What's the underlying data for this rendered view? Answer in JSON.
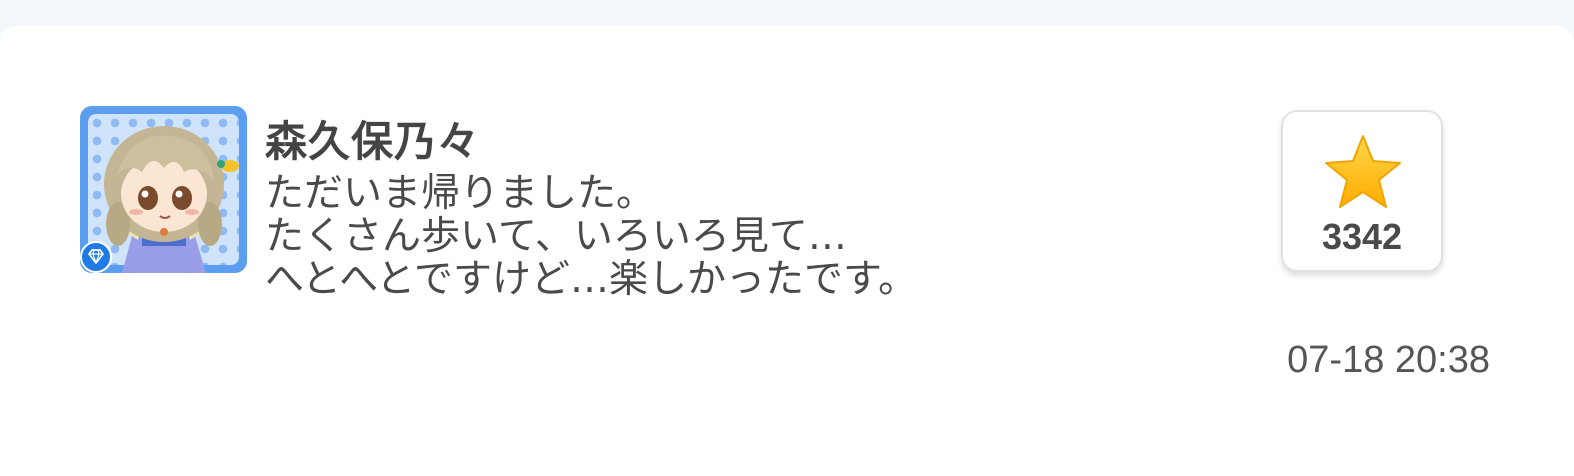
{
  "post": {
    "author_name": "森久保乃々",
    "message_lines": [
      "ただいま帰りました。",
      "たくさん歩いて、いろいろ見て…",
      "へとへとですけど…楽しかったです。"
    ],
    "star_count": "3342",
    "timestamp": "07-18 20:38",
    "avatar_icon": "character-avatar-icon",
    "badge_icon": "diamond-icon",
    "star_icon": "star-icon"
  },
  "colors": {
    "avatar_frame": "#5b9ef0",
    "badge": "#1f7ae6",
    "star": "#ffc21a",
    "text": "#4a4a4a"
  }
}
